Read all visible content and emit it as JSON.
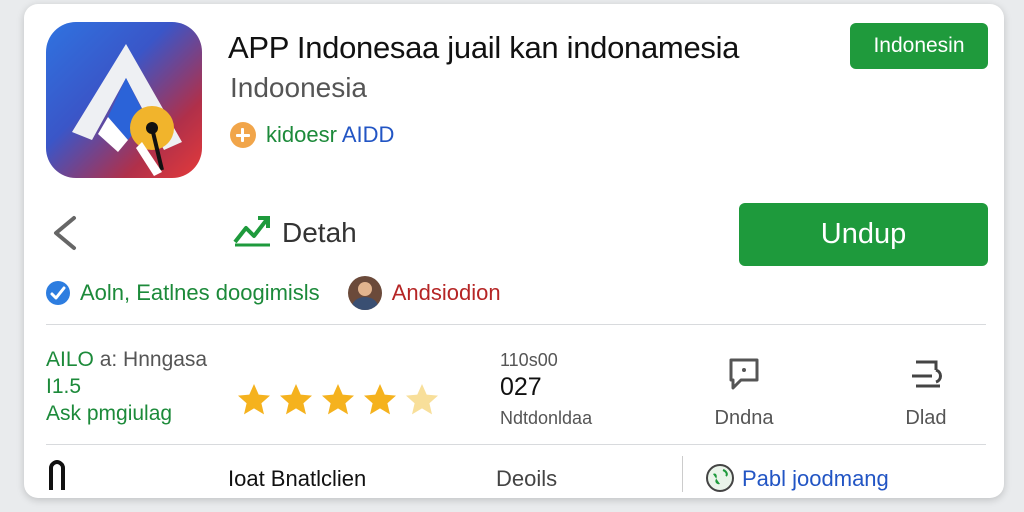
{
  "app": {
    "title": "APP Indonesaa juail kan indonamesia",
    "subtitle": "Indoonesia",
    "developer_label": "kidoesr",
    "developer_tag": "AIDD",
    "corner_button": "Indonesin"
  },
  "actions": {
    "detail_label": "Detah",
    "install_button": "Undup"
  },
  "tags": {
    "left": "Aoln, Eatlnes doogimisls",
    "right": "Andsiodion"
  },
  "rating": {
    "line1_label": "AILO",
    "line1_text": "a: Hnngasa",
    "line2": "I1.5",
    "line3": "Ask pmgiulag",
    "stars_filled": 4,
    "stars_total": 5
  },
  "count": {
    "top": "110s00",
    "middle": "027",
    "bottom": "Ndtdonldaa"
  },
  "stats": [
    {
      "icon": "chat-icon",
      "label": "Dndna"
    },
    {
      "icon": "document-icon",
      "label": "Dlad"
    }
  ],
  "bottom": {
    "left": "Ioat Bnatlclien",
    "middle": "Deoils",
    "right": "Pabl joodmang"
  },
  "colors": {
    "brand_green": "#1e9a3c",
    "link_blue": "#2255c4",
    "star_gold": "#f5b21e"
  }
}
